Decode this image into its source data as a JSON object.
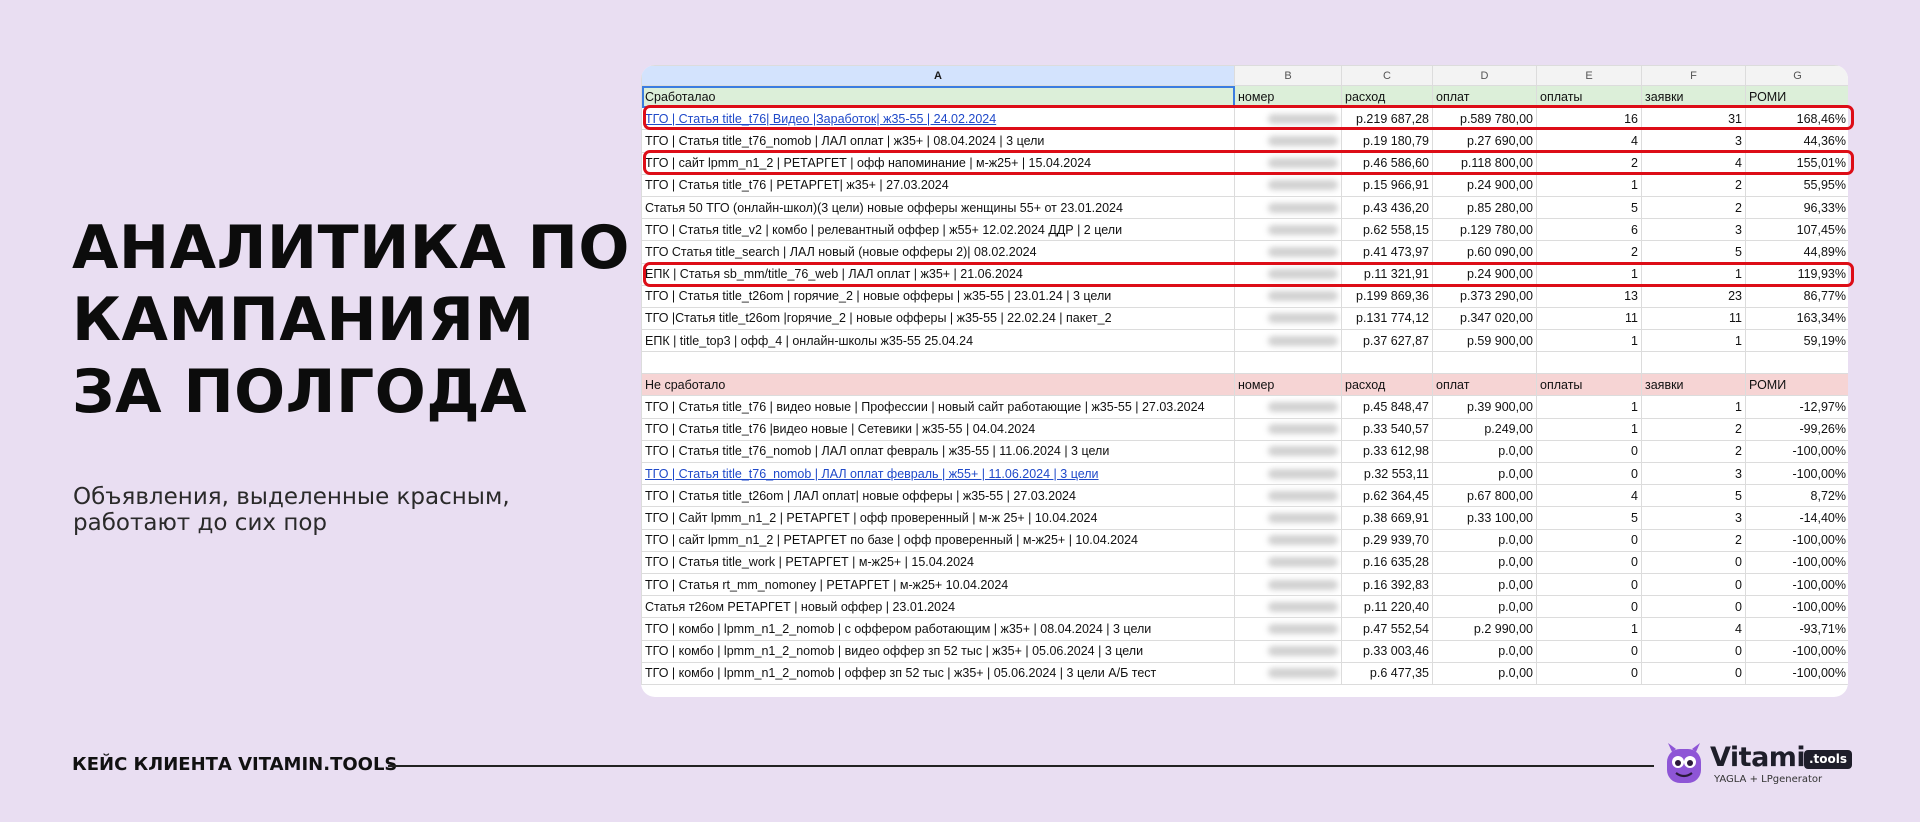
{
  "headline": [
    "АНАЛИТИКА ПО",
    "КАМПАНИЯМ",
    "ЗА ПОЛГОДА"
  ],
  "subtitle": [
    "Объявления, выделенные красным,",
    "работают до сих пор"
  ],
  "footer": {
    "client_label": "КЕЙС КЛИЕНТА VITAMIN.TOOLS"
  },
  "logo": {
    "word": "Vitamin",
    "badge": ".tools",
    "tagline": "YAGLA + LPgenerator"
  },
  "colors": {
    "background": "#e9def2",
    "highlight": "#dd0d17",
    "worked_header": "#dcefd9",
    "not_worked_header": "#f6d4d4",
    "link": "#1f49c9"
  },
  "sheet": {
    "col_letters": [
      "A",
      "B",
      "C",
      "D",
      "E",
      "F",
      "G"
    ],
    "worked_header": [
      "Сработалао",
      "номер",
      "расход",
      "оплат",
      "оплаты",
      "заявки",
      "РОМИ"
    ],
    "worked_rows": [
      {
        "name": "ТГО | Статья title_t76| Видео |Заработок| ж35-55 | 24.02.2024",
        "link": true,
        "hl": true,
        "rashod": "р.219 687,28",
        "oplat": "р.589 780,00",
        "oplaty": "16",
        "zayavki": "31",
        "romi": "168,46%"
      },
      {
        "name": "ТГО | Статья title_t76_nomob | ЛАЛ оплат | ж35+ | 08.04.2024 | 3 цели",
        "rashod": "р.19 180,79",
        "oplat": "р.27 690,00",
        "oplaty": "4",
        "zayavki": "3",
        "romi": "44,36%"
      },
      {
        "name": "ТГО | сайт lpmm_n1_2 | РЕТАРГЕТ | офф напоминание | м-ж25+ | 15.04.2024",
        "hl": true,
        "rashod": "р.46 586,60",
        "oplat": "р.118 800,00",
        "oplaty": "2",
        "zayavki": "4",
        "romi": "155,01%"
      },
      {
        "name": "ТГО | Статья title_t76 | РЕТАРГЕТ| ж35+ | 27.03.2024",
        "rashod": "р.15 966,91",
        "oplat": "р.24 900,00",
        "oplaty": "1",
        "zayavki": "2",
        "romi": "55,95%"
      },
      {
        "name": "Статья 50 ТГО (онлайн-школ)(3 цели) новые офферы женщины 55+ от 23.01.2024",
        "rashod": "р.43 436,20",
        "oplat": "р.85 280,00",
        "oplaty": "5",
        "zayavki": "2",
        "romi": "96,33%"
      },
      {
        "name": "ТГО | Статья title_v2 | комбо | релевантный оффер | ж55+ 12.02.2024 ДДР | 2 цели",
        "rashod": "р.62 558,15",
        "oplat": "р.129 780,00",
        "oplaty": "6",
        "zayavki": "3",
        "romi": "107,45%"
      },
      {
        "name": "ТГО Статья title_search | ЛАЛ новый (новые офферы 2)| 08.02.2024",
        "rashod": "р.41 473,97",
        "oplat": "р.60 090,00",
        "oplaty": "2",
        "zayavki": "5",
        "romi": "44,89%"
      },
      {
        "name": "ЕПК | Статья sb_mm/title_76_web | ЛАЛ оплат | ж35+ | 21.06.2024",
        "hl": true,
        "rashod": "р.11 321,91",
        "oplat": "р.24 900,00",
        "oplaty": "1",
        "zayavki": "1",
        "romi": "119,93%"
      },
      {
        "name": "ТГО | Статья title_t26om | горячие_2 | новые офферы | ж35-55 | 23.01.24 | 3 цели",
        "rashod": "р.199 869,36",
        "oplat": "р.373 290,00",
        "oplaty": "13",
        "zayavki": "23",
        "romi": "86,77%"
      },
      {
        "name": "ТГО |Статья title_t26om |горячие_2 | новые офферы | ж35-55 | 22.02.24 | пакет_2",
        "rashod": "р.131 774,12",
        "oplat": "р.347 020,00",
        "oplaty": "11",
        "zayavki": "11",
        "romi": "163,34%"
      },
      {
        "name": "ЕПК | title_top3 | офф_4 | онлайн-школы ж35-55 25.04.24",
        "rashod": "р.37 627,87",
        "oplat": "р.59 900,00",
        "oplaty": "1",
        "zayavki": "1",
        "romi": "59,19%"
      }
    ],
    "not_worked_header": [
      "Не сработало",
      "номер",
      "расход",
      "оплат",
      "оплаты",
      "заявки",
      "РОМИ"
    ],
    "not_worked_rows": [
      {
        "name": "ТГО | Статья title_t76 | видео новые | Профессии | новый сайт работающие | ж35-55 | 27.03.2024",
        "rashod": "р.45 848,47",
        "oplat": "р.39 900,00",
        "oplaty": "1",
        "zayavki": "1",
        "romi": "-12,97%"
      },
      {
        "name": "ТГО | Статья title_t76 |видео новые | Сетевики | ж35-55 | 04.04.2024",
        "rashod": "р.33 540,57",
        "oplat": "р.249,00",
        "oplaty": "1",
        "zayavki": "2",
        "romi": "-99,26%"
      },
      {
        "name": "ТГО | Статья title_t76_nomob | ЛАЛ оплат февраль | ж35-55 | 11.06.2024 | 3 цели",
        "rashod": "р.33 612,98",
        "oplat": "р.0,00",
        "oplaty": "0",
        "zayavki": "2",
        "romi": "-100,00%"
      },
      {
        "name": "ТГО | Статья title_t76_nomob | ЛАЛ оплат февраль | ж55+ | 11.06.2024 | 3 цели",
        "link": true,
        "rashod": "р.32 553,11",
        "oplat": "р.0,00",
        "oplaty": "0",
        "zayavki": "3",
        "romi": "-100,00%"
      },
      {
        "name": "ТГО | Статья title_t26om | ЛАЛ оплат| новые офферы | ж35-55 | 27.03.2024",
        "rashod": "р.62 364,45",
        "oplat": "р.67 800,00",
        "oplaty": "4",
        "zayavki": "5",
        "romi": "8,72%"
      },
      {
        "name": "ТГО | Сайт lpmm_n1_2 | РЕТАРГЕТ | офф проверенный | м-ж 25+ | 10.04.2024",
        "rashod": "р.38 669,91",
        "oplat": "р.33 100,00",
        "oplaty": "5",
        "zayavki": "3",
        "romi": "-14,40%"
      },
      {
        "name": "ТГО | сайт lpmm_n1_2 | РЕТАРГЕТ по базе | офф проверенный | м-ж25+ | 10.04.2024",
        "rashod": "р.29 939,70",
        "oplat": "р.0,00",
        "oplaty": "0",
        "zayavki": "2",
        "romi": "-100,00%"
      },
      {
        "name": "ТГО | Статья title_work | РЕТАРГЕТ | м-ж25+ | 15.04.2024",
        "rashod": "р.16 635,28",
        "oplat": "р.0,00",
        "oplaty": "0",
        "zayavki": "0",
        "romi": "-100,00%"
      },
      {
        "name": "ТГО | Статья rt_mm_nomoney | РЕТАРГЕТ | м-ж25+ 10.04.2024",
        "rashod": "р.16 392,83",
        "oplat": "р.0,00",
        "oplaty": "0",
        "zayavki": "0",
        "romi": "-100,00%"
      },
      {
        "name": "Статья т26ом РЕТАРГЕТ | новый оффер | 23.01.2024",
        "rashod": "р.11 220,40",
        "oplat": "р.0,00",
        "oplaty": "0",
        "zayavki": "0",
        "romi": "-100,00%"
      },
      {
        "name": "ТГО | комбо | lpmm_n1_2_nomob | с оффером работающим | ж35+ | 08.04.2024 | 3 цели",
        "rashod": "р.47 552,54",
        "oplat": "р.2 990,00",
        "oplaty": "1",
        "zayavki": "4",
        "romi": "-93,71%"
      },
      {
        "name": "ТГО | комбо | lpmm_n1_2_nomob | видео оффер зп 52 тыс | ж35+ | 05.06.2024 | 3 цели",
        "rashod": "р.33 003,46",
        "oplat": "р.0,00",
        "oplaty": "0",
        "zayavki": "0",
        "romi": "-100,00%"
      },
      {
        "name": "ТГО | комбо | lpmm_n1_2_nomob | оффер зп 52 тыс | ж35+ | 05.06.2024 | 3 цели А/Б тест",
        "rashod": "р.6 477,35",
        "oplat": "р.0,00",
        "oplaty": "0",
        "zayavki": "0",
        "romi": "-100,00%"
      }
    ]
  }
}
